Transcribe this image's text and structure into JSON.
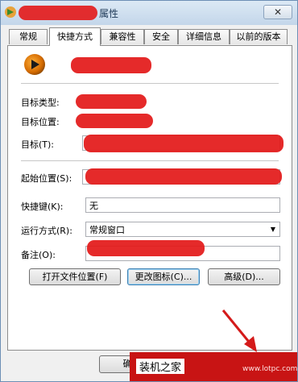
{
  "window": {
    "title_suffix": "属性",
    "close_glyph": "✕"
  },
  "tabs": [
    {
      "label": "常规"
    },
    {
      "label": "快捷方式"
    },
    {
      "label": "兼容性"
    },
    {
      "label": "安全"
    },
    {
      "label": "详细信息"
    },
    {
      "label": "以前的版本"
    }
  ],
  "form": {
    "target_type_label": "目标类型:",
    "target_location_label": "目标位置:",
    "target_label": "目标(T):",
    "start_in_label": "起始位置(S):",
    "hotkey_label": "快捷键(K):",
    "hotkey_value": "无",
    "run_label": "运行方式(R):",
    "run_value": "常规窗口",
    "comment_label": "备注(O):"
  },
  "buttons": {
    "open_location": "打开文件位置(F)",
    "change_icon": "更改图标(C)...",
    "advanced": "高级(D)...",
    "ok": "确"
  },
  "watermark": {
    "text": "装机之家",
    "url": "www.lotpc.com"
  },
  "icons": {
    "app": "media-player-icon",
    "close": "close-icon",
    "dropdown": "chevron-down-icon"
  },
  "colors": {
    "redaction": "#e31818",
    "watermark_bg": "#c81414",
    "arrow": "#d41a1a"
  }
}
